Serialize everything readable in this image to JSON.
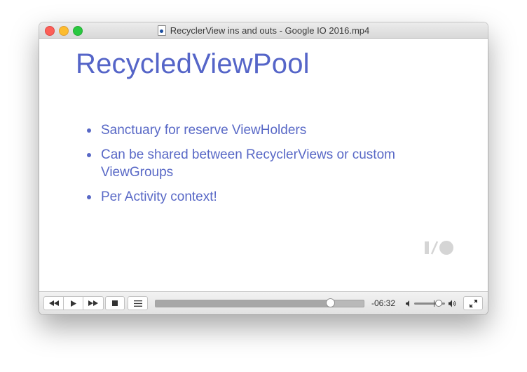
{
  "window": {
    "title": "RecyclerView ins and outs - Google IO 2016.mp4"
  },
  "slide": {
    "title": "RecycledViewPool",
    "bullets": [
      "Sanctuary for reserve ViewHolders",
      "Can be shared between RecyclerViews or custom ViewGroups",
      "Per Activity context!"
    ],
    "logo_icon": "google-io-logo"
  },
  "player": {
    "remaining_time": "-06:32",
    "playback_progress": 0.84,
    "volume_level": 0.8,
    "icons": [
      "rewind-icon",
      "play-icon",
      "fast-forward-icon",
      "stop-icon",
      "playlist-icon",
      "volume-low-icon",
      "volume-high-icon",
      "fullscreen-icon"
    ]
  },
  "colors": {
    "slide_text": "#5868c6",
    "close": "#fc5f57",
    "minimize": "#fdbc2e",
    "maximize": "#29c840"
  }
}
